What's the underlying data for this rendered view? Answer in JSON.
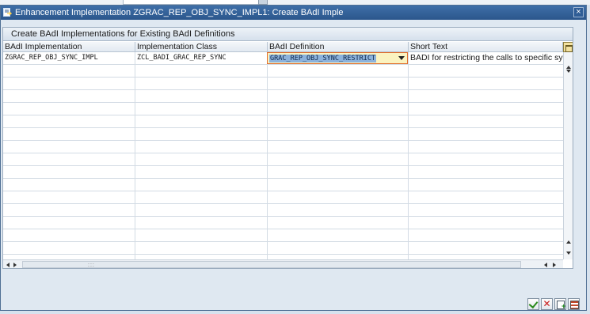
{
  "dialog": {
    "title": "Enhancement Implementation ZGRAC_REP_OBJ_SYNC_IMPL1: Create BAdI Imple",
    "close_symbol": "×"
  },
  "grid": {
    "title": "Create BAdI Implementations for Existing BAdI Definitions",
    "columns": [
      "BAdI Implementation",
      "Implementation Class",
      "BAdI Definition",
      "Short Text"
    ],
    "rows": [
      {
        "badi_implementation": "ZGRAC_REP_OBJ_SYNC_IMPL",
        "implementation_class": "ZCL_BADI_GRAC_REP_SYNC",
        "badi_definition": "GRAC_REP_OBJ_SYNC_RESTRICT",
        "short_text": "BADI for restricting the calls to specific synch"
      }
    ],
    "scroll_grip": ":::"
  },
  "icons": {
    "title": "enhancement-icon",
    "layout": "layout-settings-icon",
    "ok": "check-icon",
    "cancel": "cancel-icon",
    "new": "new-entry-icon",
    "list": "list-icon"
  },
  "colors": {
    "title_bar": "#2f5d96",
    "selection": "#8cb2dc",
    "focus_border": "#e06b2a",
    "ok": "#2a8a1c",
    "cancel": "#c81b1b"
  }
}
